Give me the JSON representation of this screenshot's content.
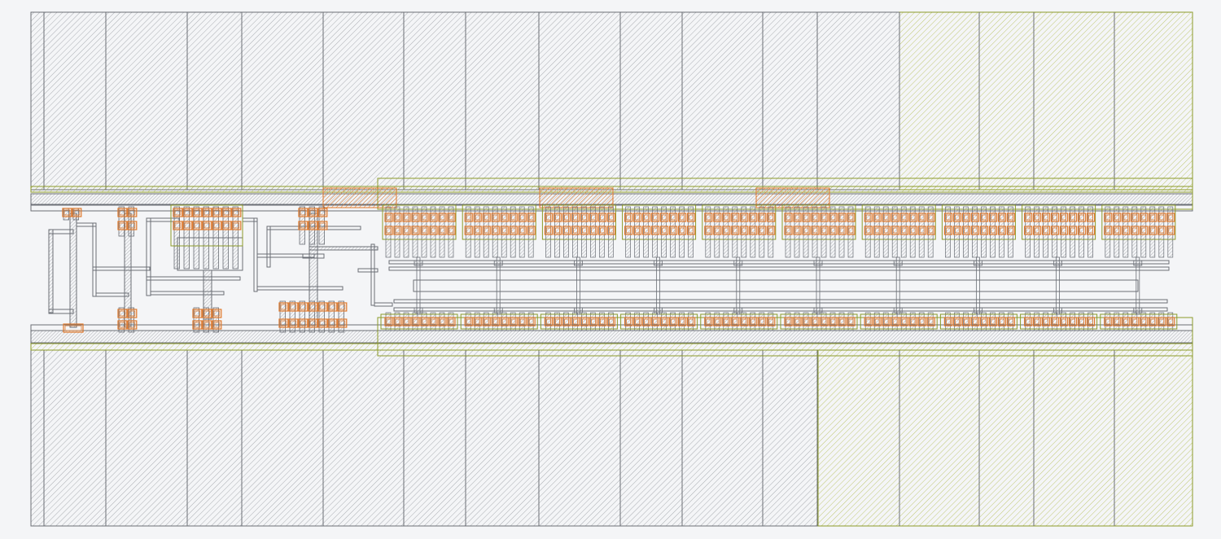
{
  "layout_view": {
    "background_color": "#f4f5f7",
    "layers": [
      {
        "name": "metal-grey",
        "color": "#6b6f76",
        "pattern": "hatch-45"
      },
      {
        "name": "nwell-olive",
        "color": "#8c9a2a",
        "pattern": "hatch-45"
      },
      {
        "name": "contact-orange",
        "color": "#e0782a",
        "pattern": "hatch-45"
      }
    ],
    "finger_groups": {
      "top_row_count": 10,
      "bottom_row_count": 10,
      "fingers_per_group": 8
    }
  }
}
